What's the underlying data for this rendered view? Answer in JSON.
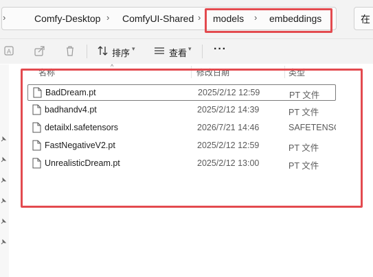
{
  "address_bar": {
    "back_glyph": "›",
    "crumbs": [
      "Comfy-Desktop",
      "ComfyUI-Shared",
      "models",
      "embeddings"
    ],
    "separator": "›",
    "search_partial": "在"
  },
  "toolbar": {
    "sort_label": "排序",
    "view_label": "查看",
    "more_label": "···"
  },
  "columns": {
    "name": "名称",
    "date": "修改日期",
    "type": "类型"
  },
  "files": [
    {
      "name": "BadDream.pt",
      "date": "2025/2/12 12:59",
      "type": "PT 文件"
    },
    {
      "name": "badhandv4.pt",
      "date": "2025/2/12 14:39",
      "type": "PT 文件"
    },
    {
      "name": "detailxl.safetensors",
      "date": "2026/7/21 14:46",
      "type": "SAFETENSORS"
    },
    {
      "name": "FastNegativeV2.pt",
      "date": "2025/2/12 12:59",
      "type": "PT 文件"
    },
    {
      "name": "UnrealisticDream.pt",
      "date": "2025/2/12 13:00",
      "type": "PT 文件"
    }
  ],
  "colors": {
    "highlight": "#e34a4f",
    "chrome": "#f3f3f3"
  }
}
